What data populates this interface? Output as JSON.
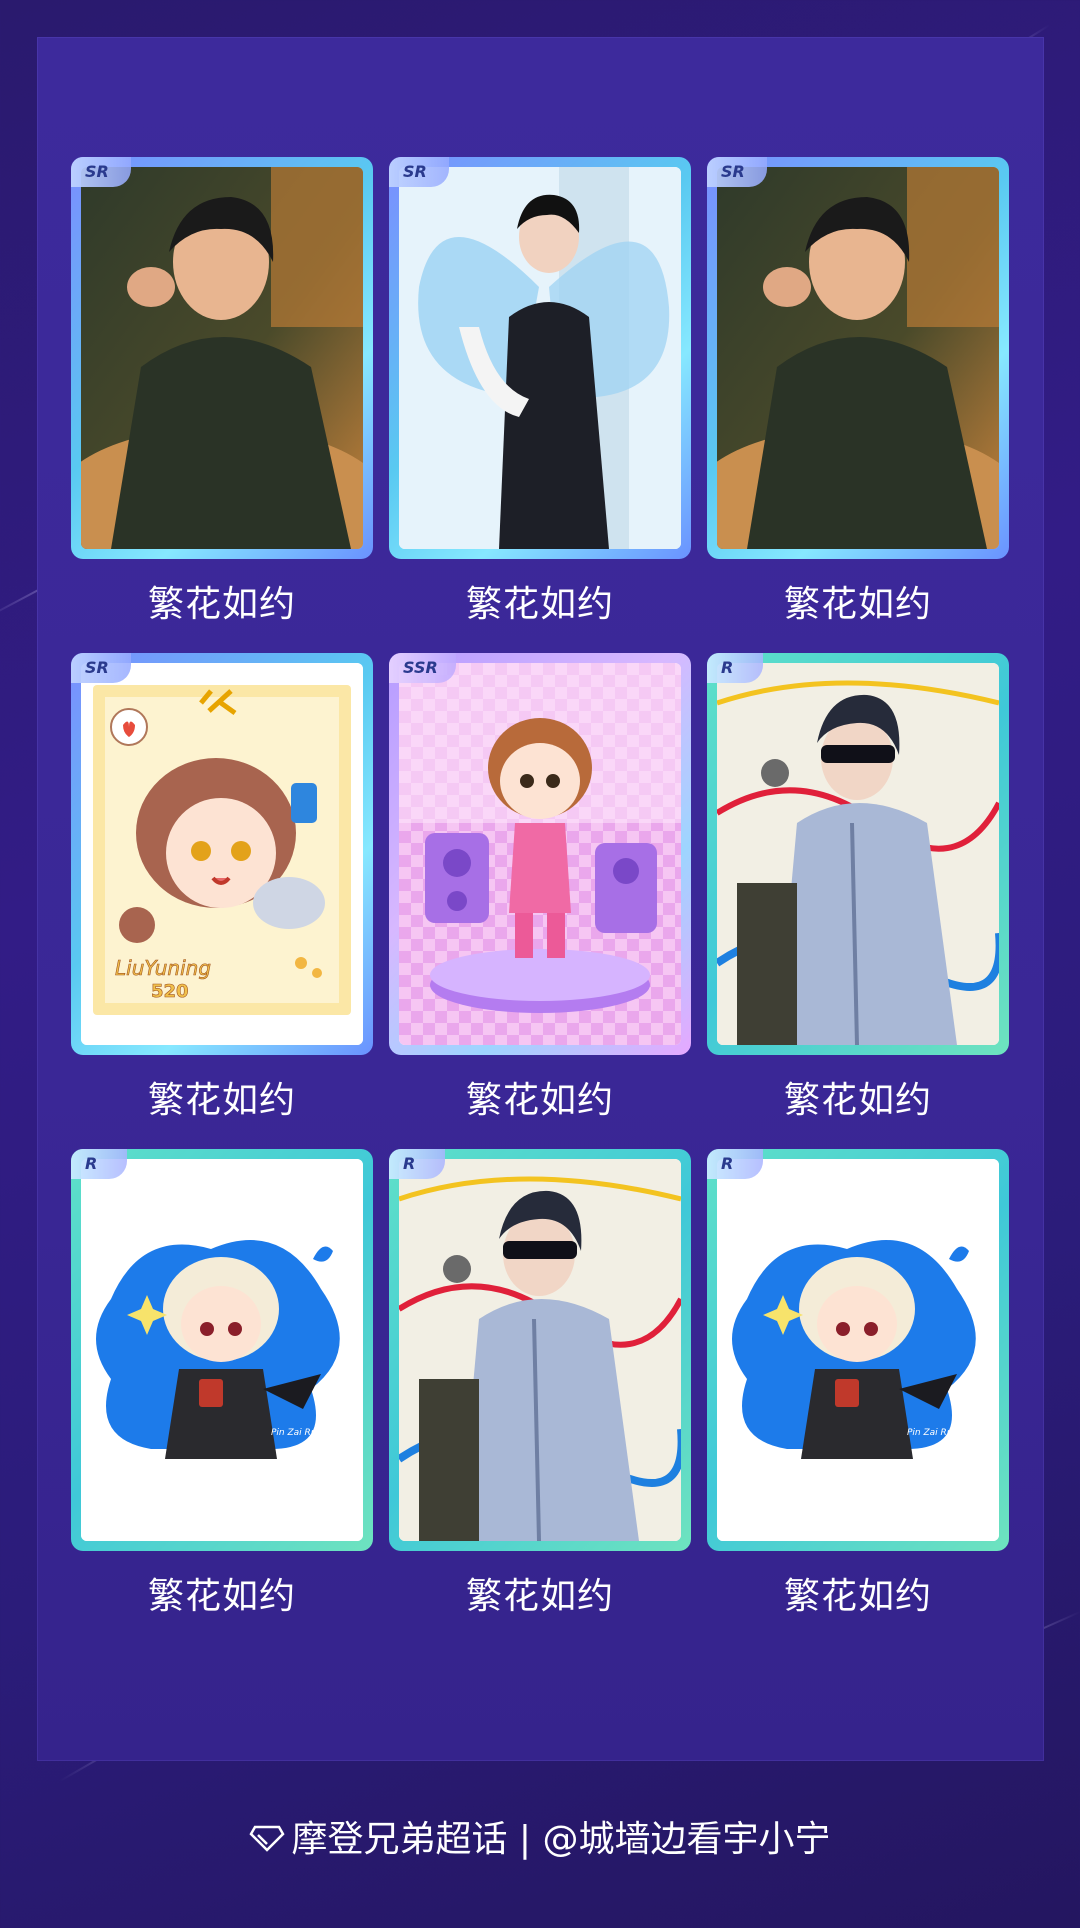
{
  "cards": [
    {
      "rarity": "SR",
      "caption": "繁花如约",
      "art": "portrait-dark-sweater"
    },
    {
      "rarity": "SR",
      "caption": "繁花如约",
      "art": "suit-butterfly-wings"
    },
    {
      "rarity": "SR",
      "caption": "繁花如约",
      "art": "portrait-dark-sweater"
    },
    {
      "rarity": "SR",
      "caption": "繁花如约",
      "art": "chibi-doodle-frame",
      "art_text": "LiuYuning 520"
    },
    {
      "rarity": "SSR",
      "caption": "繁花如约",
      "art": "chibi-pink-stage"
    },
    {
      "rarity": "R",
      "caption": "繁花如约",
      "art": "blindfold-ribbons"
    },
    {
      "rarity": "R",
      "caption": "繁花如约",
      "art": "chibi-blonde-blue-splash"
    },
    {
      "rarity": "R",
      "caption": "繁花如约",
      "art": "blindfold-ribbons"
    },
    {
      "rarity": "R",
      "caption": "繁花如约",
      "art": "chibi-blonde-blue-splash"
    }
  ],
  "footer": {
    "icon": "diamond-icon",
    "text": "摩登兄弟超话 | @城墙边看宇小宁"
  },
  "colors": {
    "background": "#2f1d82",
    "panel": "#3b2898",
    "frame_r": "#4fd6cc",
    "frame_sr": "#68b8f4",
    "frame_ssr": "#c8a8ff"
  }
}
